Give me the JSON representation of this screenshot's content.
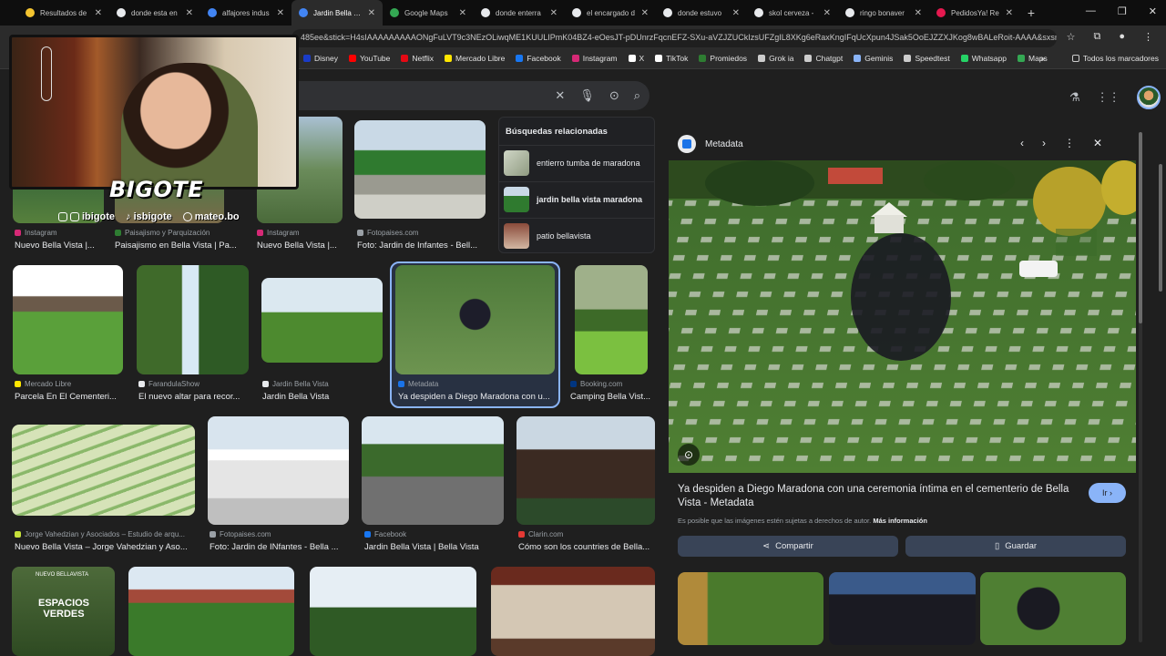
{
  "tabs": [
    {
      "label": "Resultados de",
      "color": "#f4c430"
    },
    {
      "label": "donde esta en",
      "color": "#e8eaed"
    },
    {
      "label": "alfajores indus",
      "color": "#4285f4"
    },
    {
      "label": "Jardin Bella Vis",
      "color": "#4285f4",
      "active": true
    },
    {
      "label": "Google Maps",
      "color": "#34a853"
    },
    {
      "label": "donde enterra",
      "color": "#e8eaed"
    },
    {
      "label": "el encargado d",
      "color": "#e8eaed"
    },
    {
      "label": "donde estuvo",
      "color": "#e8eaed"
    },
    {
      "label": "skol cerveza -",
      "color": "#e8eaed"
    },
    {
      "label": "ringo bonaver",
      "color": "#e8eaed"
    },
    {
      "label": "PedidosYa! Re",
      "color": "#e5194f"
    }
  ],
  "address": {
    "url": "485ee&stick=H4sIAAAAAAAAAONgFuLVT9c3NEzOLiwqME1KUULIPmK04BZ4-eOesJT-pDUnrzFqcnEFZ-SXu-aVZJZUCkIzsUFZgIL8XKg6eRaxKngIFqUcXpun4JSak5OoEJZZXJKog8wBALeRoit-AAAA&sxsrf..."
  },
  "bookmarks": [
    {
      "label": "Disney",
      "color": "#1a3cc8"
    },
    {
      "label": "YouTube",
      "color": "#ff0000"
    },
    {
      "label": "Netflix",
      "color": "#e50914"
    },
    {
      "label": "Mercado Libre",
      "color": "#ffe600"
    },
    {
      "label": "Facebook",
      "color": "#1877f2"
    },
    {
      "label": "Instagram",
      "color": "#d62976"
    },
    {
      "label": "X",
      "color": "#ffffff"
    },
    {
      "label": "TikTok",
      "color": "#ffffff"
    },
    {
      "label": "Promiedos",
      "color": "#2e7d32"
    },
    {
      "label": "Grok ia",
      "color": "#cccccc"
    },
    {
      "label": "Chatgpt",
      "color": "#cccccc"
    },
    {
      "label": "Geminis",
      "color": "#8ab4f8"
    },
    {
      "label": "Speedtest",
      "color": "#cccccc"
    },
    {
      "label": "Whatsapp",
      "color": "#25d366"
    },
    {
      "label": "Maps",
      "color": "#34a853"
    }
  ],
  "bookmarks_folder": "Todos los marcadores",
  "grid": {
    "row1": [
      {
        "source": "Instagram",
        "caption": "Nuevo Bella Vista |...",
        "src_color": "#d62976"
      },
      {
        "source": "Paisajismo y Parquización",
        "caption": "Paisajismo en Bella Vista | Pa...",
        "src_color": "#2e7d32"
      },
      {
        "source": "Instagram",
        "caption": "Nuevo Bella Vista |...",
        "src_color": "#d62976"
      },
      {
        "source": "Fotopaises.com",
        "caption": "Foto: Jardin de Infantes - Bell...",
        "src_color": "#9aa0a6"
      }
    ],
    "row2": [
      {
        "source": "Mercado Libre",
        "caption": "Parcela En El Cementeri...",
        "src_color": "#ffe600"
      },
      {
        "source": "FarandulaShow",
        "caption": "El nuevo altar para recor...",
        "src_color": "#e8eaed"
      },
      {
        "source": "Jardin Bella Vista",
        "caption": "Jardin Bella Vista",
        "src_color": "#e8eaed"
      },
      {
        "source": "Metadata",
        "caption": "Ya despiden a Diego Maradona con u...",
        "src_color": "#1a73e8"
      },
      {
        "source": "Booking.com",
        "caption": "Camping Bella Vist...",
        "src_color": "#003580"
      }
    ],
    "row3": [
      {
        "source": "Jorge Vahedzian y Asociados – Estudio de arqu...",
        "caption": "Nuevo Bella Vista – Jorge Vahedzian y Aso...",
        "src_color": "#c6e03a"
      },
      {
        "source": "Fotopaises.com",
        "caption": "Foto: Jardin de INfantes - Bella ...",
        "src_color": "#9aa0a6"
      },
      {
        "source": "Facebook",
        "caption": "Jardin Bella Vista | Bella Vista",
        "src_color": "#1877f2"
      },
      {
        "source": "Clarin.com",
        "caption": "Cómo son los countries de Bella...",
        "src_color": "#e53935"
      }
    ],
    "row4_overlay_text": "ESPACIOS VERDES",
    "row4_overlay_sub": "NUEVO BELLAVISTA"
  },
  "related": {
    "title": "Búsquedas relacionadas",
    "items": [
      {
        "text": "entierro tumba de maradona",
        "bold": false
      },
      {
        "text": "jardin bella vista maradona",
        "bold": true
      },
      {
        "text": "patio bellavista",
        "bold": false
      }
    ]
  },
  "overlay": {
    "brand": "BIGOTE",
    "socials": [
      {
        "handle": "ibigote"
      },
      {
        "handle": "isbigote"
      },
      {
        "handle": "mateo.bo"
      }
    ]
  },
  "panel": {
    "source": "Metadata",
    "title": "Ya despiden a Diego Maradona con una ceremonia íntima en el cementerio de Bella Vista - Metadata",
    "visit_label": "Ir",
    "rights_text": "Es posible que las imágenes estén sujetas a derechos de autor.",
    "rights_link": "Más información",
    "share_label": "Compartir",
    "save_label": "Guardar"
  },
  "accent": "#8ab4f8"
}
